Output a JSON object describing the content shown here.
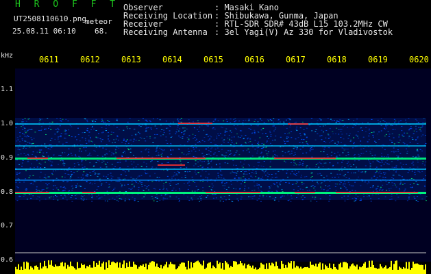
{
  "header": {
    "app_title": "H R O F F T",
    "filename": "UT2508110610.png",
    "mode_label": "meteor",
    "datetime": "25.08.11 06:10",
    "count": "68.",
    "info_labels": [
      "Observer",
      "Receiving Location",
      "Receiver",
      "Receiving Antenna"
    ],
    "info_values": [
      ": Masaki Kano",
      ": Shibukawa, Gunma, Japan",
      ": RTL-SDR SDR# 43dB L15 103.2MHz CW",
      ": 3el Yagi(V) Az 330 for Vladivostok"
    ]
  },
  "axes": {
    "y_unit": "kHz",
    "y_ticks": [
      "1.1",
      "1.0",
      "0.9",
      "0.8",
      "0.7",
      "0.6"
    ],
    "x_ticks": [
      "0611",
      "0612",
      "0613",
      "0614",
      "0615",
      "0616",
      "0617",
      "0618",
      "0619",
      "0620"
    ]
  },
  "colors": {
    "background": "#000000",
    "plot_background": "#000022",
    "text": "#e6e6e6",
    "title": "#1ec81e",
    "time_labels": "#ffff00",
    "signal_strong": "#ff3030",
    "signal_medium": "#00ff80",
    "noise": "#0050ff",
    "level_bar": "#ffff00"
  }
}
